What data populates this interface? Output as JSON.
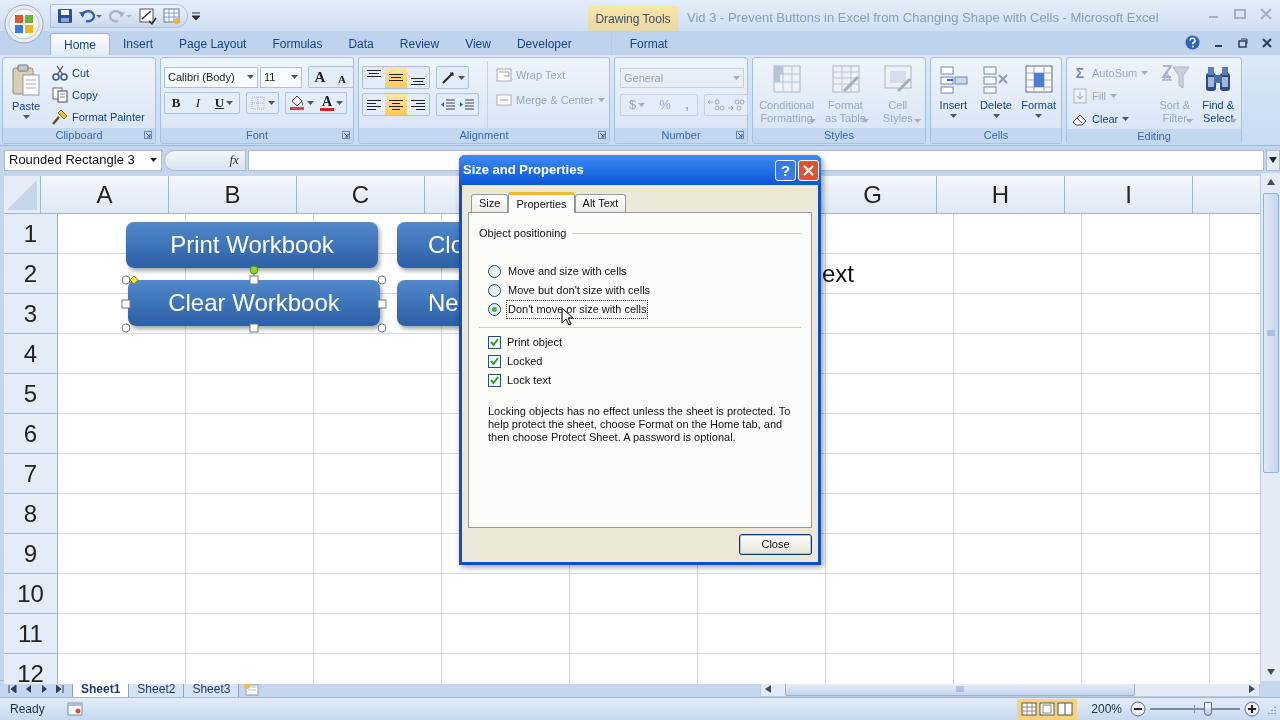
{
  "title_bar": {
    "contextual_group": "Drawing Tools",
    "title": "Vid 3 - Prevent Buttons in Excel from Changing Shape with Cells - Microsoft Excel"
  },
  "ribbon_tabs": [
    {
      "label": "Home",
      "selected": true,
      "contextual": false
    },
    {
      "label": "Insert",
      "selected": false,
      "contextual": false
    },
    {
      "label": "Page Layout",
      "selected": false,
      "contextual": false
    },
    {
      "label": "Formulas",
      "selected": false,
      "contextual": false
    },
    {
      "label": "Data",
      "selected": false,
      "contextual": false
    },
    {
      "label": "Review",
      "selected": false,
      "contextual": false
    },
    {
      "label": "View",
      "selected": false,
      "contextual": false
    },
    {
      "label": "Developer",
      "selected": false,
      "contextual": false
    },
    {
      "label": "Format",
      "selected": false,
      "contextual": true
    }
  ],
  "clipboard": {
    "label": "Clipboard",
    "paste": "Paste",
    "cut": "Cut",
    "copy": "Copy",
    "format_painter": "Format Painter"
  },
  "font": {
    "label": "Font",
    "font_name": "Calibri (Body)",
    "font_size": "11",
    "grow_font": "A",
    "shrink_font": "A",
    "bold": "B",
    "italic": "I",
    "underline": "U",
    "font_color": "A"
  },
  "alignment": {
    "label": "Alignment",
    "vertical_buttons": [
      {
        "selected": false
      },
      {
        "selected": true
      },
      {
        "selected": false
      }
    ],
    "horizontal_buttons": [
      {
        "selected": false
      },
      {
        "selected": true
      },
      {
        "selected": false
      }
    ],
    "wrap_text": {
      "label": "Wrap Text",
      "disabled": true
    },
    "merge_center": {
      "label": "Merge & Center",
      "disabled": true
    }
  },
  "number": {
    "label": "Number",
    "disabled": true,
    "format": "General",
    "currency": "$",
    "percent": "%",
    "comma": ","
  },
  "styles": {
    "label": "Styles",
    "buttons": [
      {
        "label": "Conditional\nFormatting",
        "disabled": true,
        "dropdown": true
      },
      {
        "label": "Format\nas Table",
        "disabled": true,
        "dropdown": true
      },
      {
        "label": "Cell\nStyles",
        "disabled": true,
        "dropdown": true
      }
    ]
  },
  "cells": {
    "label": "Cells",
    "buttons": [
      {
        "label": "Insert",
        "disabled": false
      },
      {
        "label": "Delete",
        "disabled": false
      },
      {
        "label": "Format",
        "disabled": false
      }
    ]
  },
  "editing": {
    "label": "Editing",
    "autosum_symbol": "Σ",
    "small_buttons": [
      {
        "label": "AutoSum",
        "disabled": true,
        "kind": "autosum"
      },
      {
        "label": "Fill",
        "disabled": true,
        "kind": "fill"
      },
      {
        "label": "Clear",
        "disabled": false,
        "kind": "clear"
      }
    ],
    "large_buttons": [
      {
        "label": "Sort &\nFilter",
        "disabled": true,
        "kind": "sort"
      },
      {
        "label": "Find &\nSelect",
        "disabled": false,
        "kind": "find"
      }
    ]
  },
  "formula_bar": {
    "name_box": "Rounded Rectangle 3",
    "function_label": "fx"
  },
  "columns": [
    "A",
    "B",
    "C",
    "G",
    "H",
    "I"
  ],
  "rows": [
    "1",
    "2",
    "3",
    "4",
    "5",
    "6",
    "7",
    "8",
    "9",
    "10",
    "11",
    "12"
  ],
  "shapes": [
    {
      "text": "Print Workbook",
      "selected": false
    },
    {
      "text": "Clo",
      "selected": false
    },
    {
      "text": "Clear Workbook",
      "selected": true
    },
    {
      "text": "Ne",
      "selected": false
    }
  ],
  "cell_text": "ext",
  "dialog": {
    "title": "Size and Properties",
    "help": "?",
    "tabs": [
      {
        "label": "Size",
        "selected": false
      },
      {
        "label": "Properties",
        "selected": true
      },
      {
        "label": "Alt Text",
        "selected": false
      }
    ],
    "section": "Object positioning",
    "radios": [
      {
        "label": "Move and size with cells",
        "selected": false
      },
      {
        "label": "Move but don't size with cells",
        "selected": false
      },
      {
        "label": "Don't move or size with cells",
        "selected": true
      }
    ],
    "checkboxes": [
      {
        "label": "Print object",
        "checked": true
      },
      {
        "label": "Locked",
        "checked": true
      },
      {
        "label": "Lock text",
        "checked": true
      }
    ],
    "note": "Locking objects has no effect unless the sheet is protected. To help protect the sheet, choose Format on the Home tab, and then choose Protect Sheet. A password is optional.",
    "close_button": "Close"
  },
  "sheet_tabs": [
    {
      "label": "Sheet1",
      "selected": true
    },
    {
      "label": "Sheet2",
      "selected": false
    },
    {
      "label": "Sheet3",
      "selected": false
    }
  ],
  "status_bar": {
    "status": "Ready",
    "zoom": "200%",
    "zoom_slider": {
      "level": 0.64
    }
  }
}
